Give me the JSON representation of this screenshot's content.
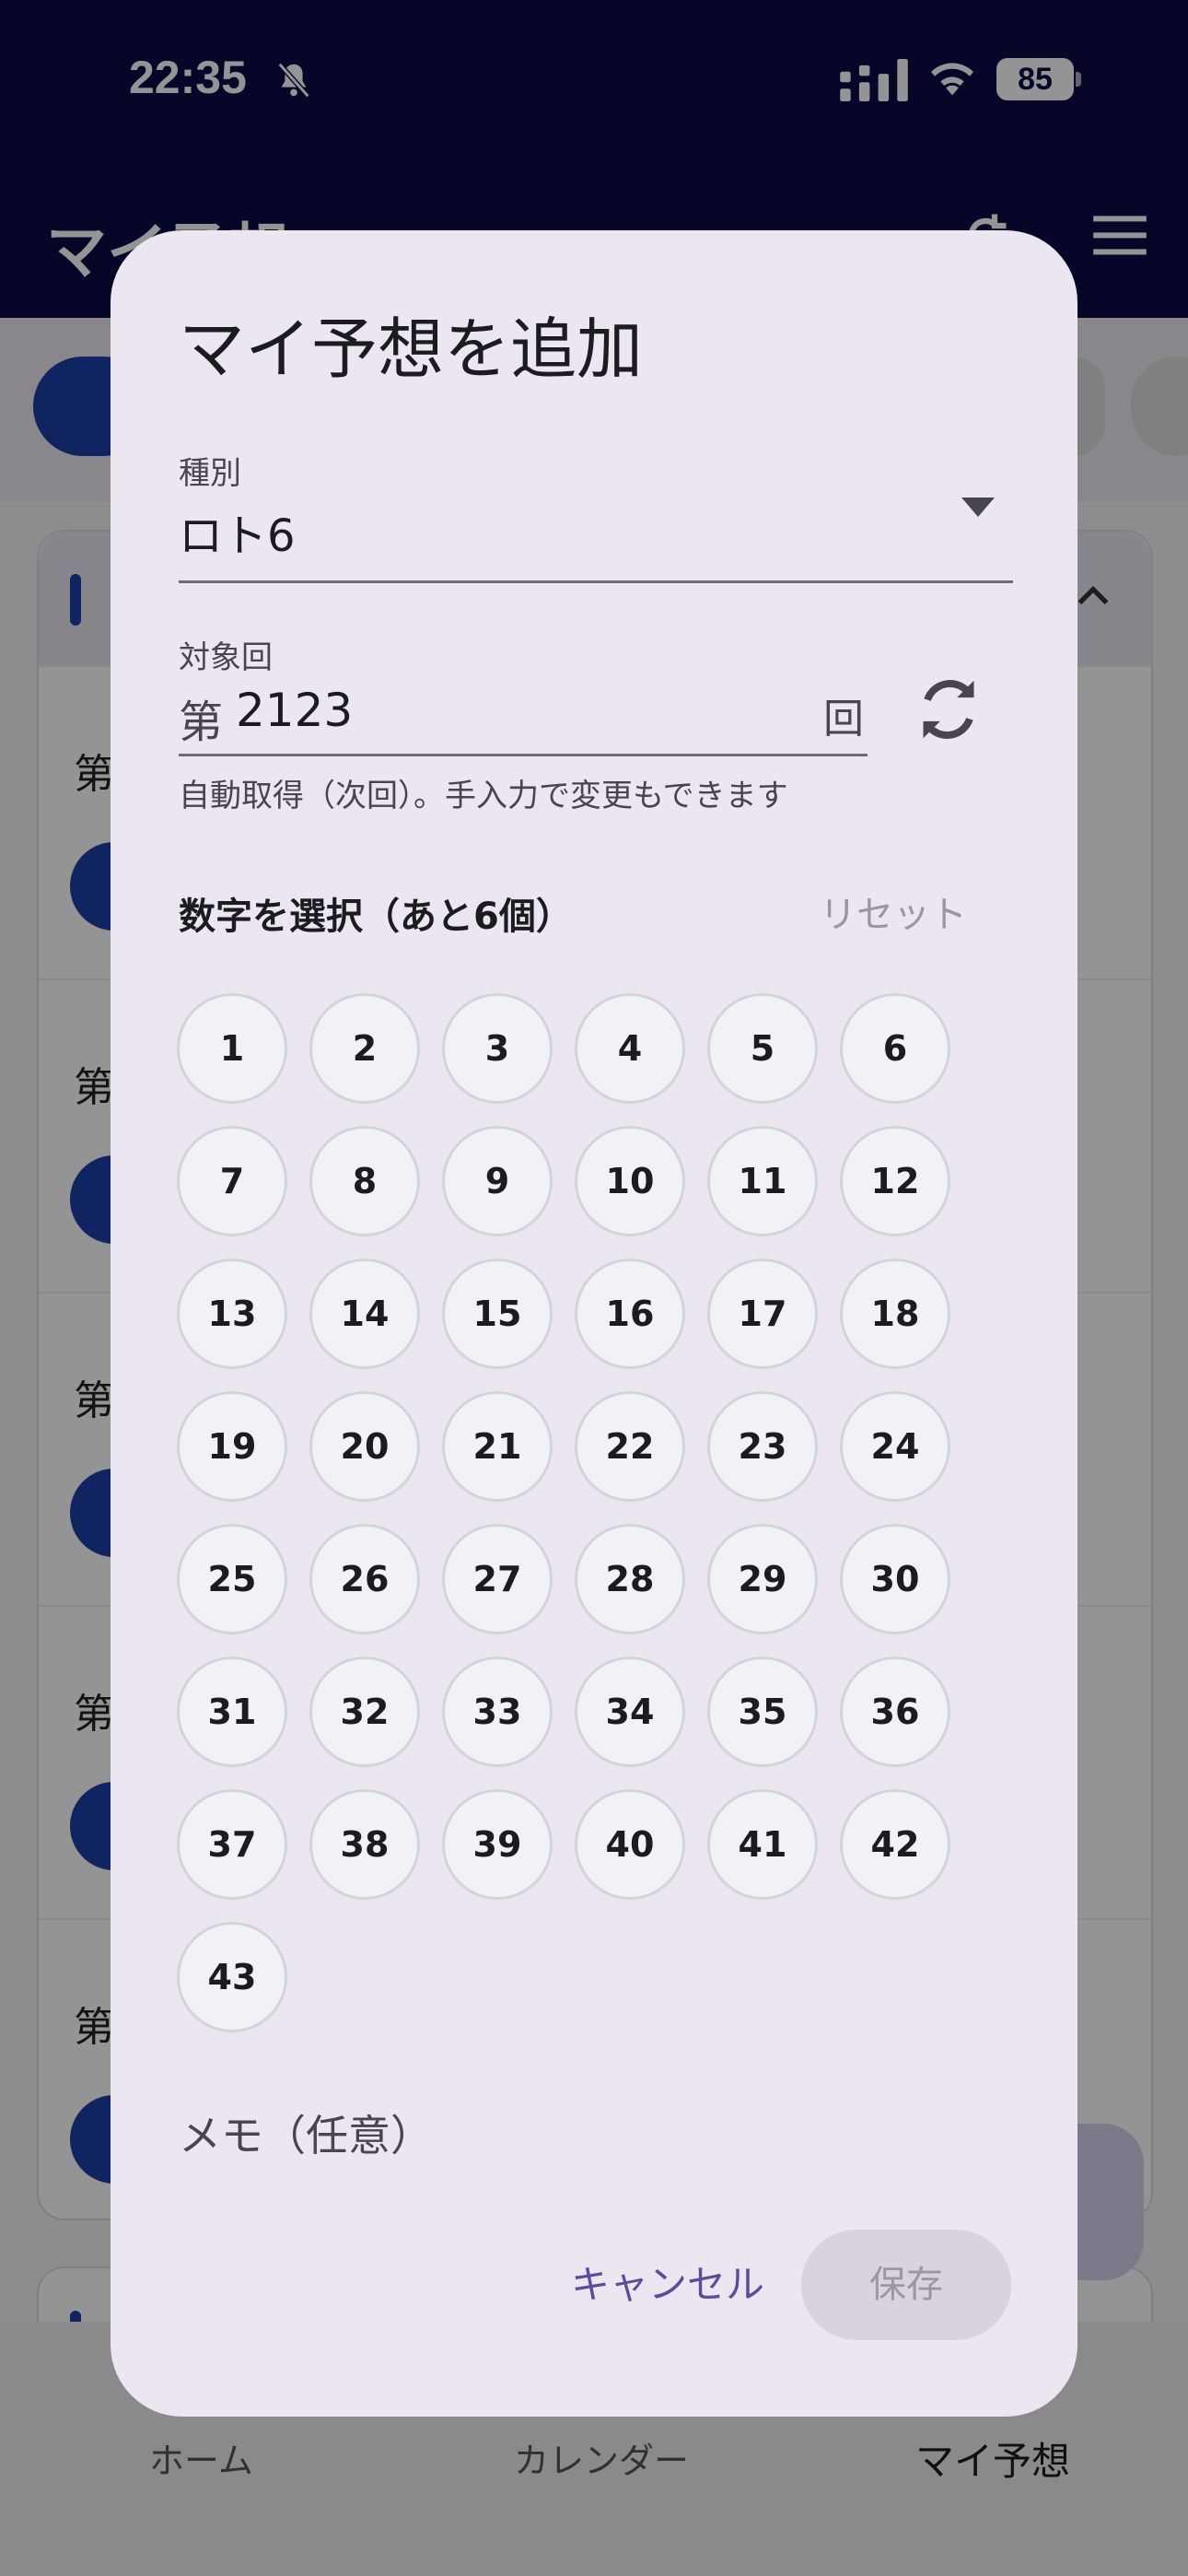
{
  "status_bar": {
    "time": "22:35",
    "battery": "85",
    "icons": [
      "bell-slash-icon",
      "cellular-signal-icon",
      "wifi-icon",
      "battery-icon"
    ]
  },
  "background": {
    "app_title": "マイ予想",
    "row_prefixes": [
      "第",
      "第",
      "第",
      "第",
      "第"
    ],
    "nav": {
      "home": "ホーム",
      "calendar": "カレンダー",
      "my_predictions": "マイ予想"
    }
  },
  "dialog": {
    "title": "マイ予想を追加",
    "type_field": {
      "label": "種別",
      "value": "ロト6"
    },
    "round_field": {
      "label": "対象回",
      "prefix": "第",
      "value": "2123",
      "suffix": "回",
      "helper": "自動取得（次回）。手入力で変更もできます"
    },
    "numbers": {
      "title": "数字を選択（あと6個）",
      "reset_label": "リセット",
      "items": [
        "1",
        "2",
        "3",
        "4",
        "5",
        "6",
        "7",
        "8",
        "9",
        "10",
        "11",
        "12",
        "13",
        "14",
        "15",
        "16",
        "17",
        "18",
        "19",
        "20",
        "21",
        "22",
        "23",
        "24",
        "25",
        "26",
        "27",
        "28",
        "29",
        "30",
        "31",
        "32",
        "33",
        "34",
        "35",
        "36",
        "37",
        "38",
        "39",
        "40",
        "41",
        "42",
        "43"
      ]
    },
    "memo_label": "メモ（任意）",
    "cancel_label": "キャンセル",
    "save_label": "保存"
  },
  "colors": {
    "header_navy": "#0c0b48",
    "accent_blue": "#1d3fa8",
    "dialog_bg": "#ece6f0",
    "cancel_text": "#5b4c9e",
    "save_disabled_bg": "#d8d3dc"
  }
}
